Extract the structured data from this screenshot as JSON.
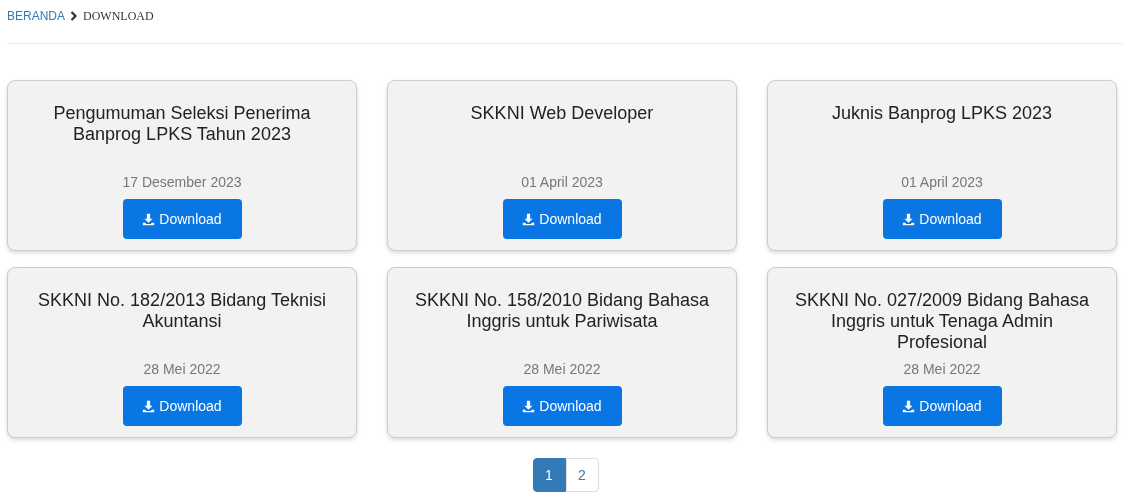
{
  "breadcrumb": [
    {
      "label": "BERANDA",
      "kind": "link"
    },
    {
      "label": "DOWNLOAD",
      "kind": "current"
    }
  ],
  "cards": [
    {
      "title": "Pengumuman Seleksi Penerima Banprog LPKS Tahun 2023",
      "date": "17 Desember 2023",
      "button": "Download"
    },
    {
      "title": "SKKNI Web Developer",
      "date": "01 April 2023",
      "button": "Download"
    },
    {
      "title": "Juknis Banprog LPKS 2023",
      "date": "01 April 2023",
      "button": "Download"
    },
    {
      "title": "SKKNI No. 182/2013 Bidang Teknisi Akuntansi",
      "date": "28 Mei 2022",
      "button": "Download"
    },
    {
      "title": "SKKNI No. 158/2010 Bidang Bahasa Inggris untuk Pariwisata",
      "date": "28 Mei 2022",
      "button": "Download"
    },
    {
      "title": "SKKNI No. 027/2009 Bidang Bahasa Inggris untuk Tenaga Admin Profesional",
      "date": "28 Mei 2022",
      "button": "Download"
    }
  ],
  "pagination": [
    {
      "label": "1",
      "selected": true
    },
    {
      "label": "2",
      "selected": false
    }
  ]
}
